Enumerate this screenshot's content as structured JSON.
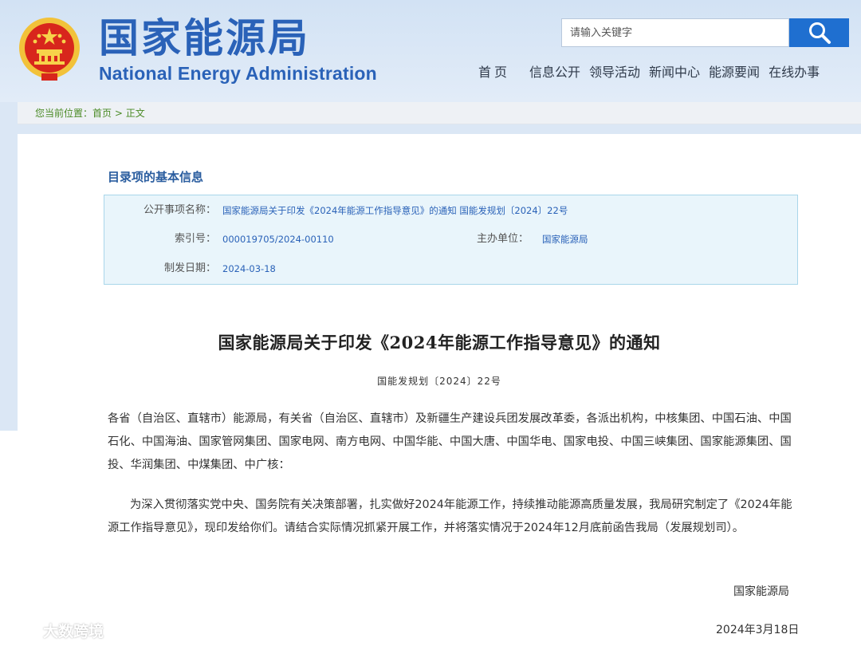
{
  "header": {
    "title_cn": "国家能源局",
    "title_en": "National Energy Administration",
    "search": {
      "placeholder": "请输入关键字",
      "icon": "search-icon"
    },
    "nav": {
      "home": "首页",
      "items": [
        "信息公开",
        "领导活动",
        "新闻中心",
        "能源要闻",
        "在线办事"
      ]
    },
    "colors": {
      "brand": "#2a62b8",
      "search_button": "#1f6fd0"
    }
  },
  "breadcrumb": {
    "prefix": "您当前位置：",
    "home": "首页",
    "separator": " > ",
    "current": "正文"
  },
  "catalog": {
    "section_title": "目录项的基本信息",
    "fields": {
      "item_name_label": "公开事项名称：",
      "item_name_value": "国家能源局关于印发《2024年能源工作指导意见》的通知 国能发规划〔2024〕22号",
      "index_label": "索引号：",
      "index_value": "000019705/2024-00110",
      "org_label": "主办单位：",
      "org_value": "国家能源局",
      "date_label": "制发日期：",
      "date_value": "2024-03-18"
    }
  },
  "document": {
    "title": "国家能源局关于印发《2024年能源工作指导意见》的通知",
    "number": "国能发规划〔2024〕22号",
    "para1": "各省（自治区、直辖市）能源局，有关省（自治区、直辖市）及新疆生产建设兵团发展改革委，各派出机构，中核集团、中国石油、中国石化、中国海油、国家管网集团、国家电网、南方电网、中国华能、中国大唐、中国华电、国家电投、中国三峡集团、国家能源集团、国投、华润集团、中煤集团、中广核：",
    "para2": "为深入贯彻落实党中央、国务院有关决策部署，扎实做好2024年能源工作，持续推动能源高质量发展，我局研究制定了《2024年能源工作指导意见》，现印发给你们。请结合实际情况抓紧开展工作，并将落实情况于2024年12月底前函告我局（发展规划司）。",
    "signature": "国家能源局",
    "sign_date": "2024年3月18日"
  },
  "watermark": {
    "text": "大数跨境"
  }
}
